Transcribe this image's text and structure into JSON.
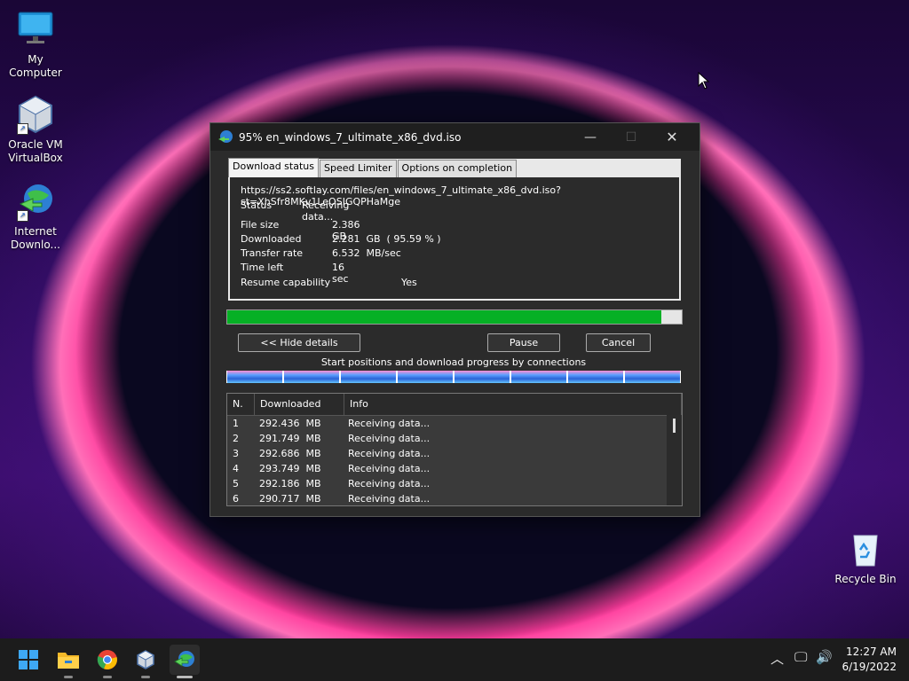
{
  "desktop": {
    "icons": [
      {
        "label": "My Computer"
      },
      {
        "label": "Oracle VM VirtualBox"
      },
      {
        "label": "Internet Downlo..."
      },
      {
        "label": "Recycle Bin"
      }
    ]
  },
  "window": {
    "title": "95% en_windows_7_ultimate_x86_dvd.iso",
    "tabs": [
      "Download status",
      "Speed Limiter",
      "Options on completion"
    ],
    "url": "https://ss2.softlay.com/files/en_windows_7_ultimate_x86_dvd.iso?st=XhSfr8MKv1LeOSIGQPHaMge",
    "status_label": "Status",
    "status_value": "Receiving data...",
    "file_size_label": "File size",
    "file_size_value": "2.386  GB",
    "downloaded_label": "Downloaded",
    "downloaded_value": "2.281  GB  ( 95.59 % )",
    "transfer_rate_label": "Transfer rate",
    "transfer_rate_value": "6.532  MB/sec",
    "time_left_label": "Time left",
    "time_left_value": "16 sec",
    "resume_label": "Resume capability",
    "resume_value": "Yes",
    "progress_percent": 95.59,
    "hide_details_label": "<< Hide details",
    "pause_label": "Pause",
    "cancel_label": "Cancel",
    "connections_label": "Start positions and download progress by connections",
    "connection_segments": 8,
    "table_headers": [
      "N.",
      "Downloaded",
      "Info"
    ],
    "rows": [
      {
        "n": "1",
        "downloaded": "292.436  MB",
        "info": "Receiving data..."
      },
      {
        "n": "2",
        "downloaded": "291.749  MB",
        "info": "Receiving data..."
      },
      {
        "n": "3",
        "downloaded": "292.686  MB",
        "info": "Receiving data..."
      },
      {
        "n": "4",
        "downloaded": "293.749  MB",
        "info": "Receiving data..."
      },
      {
        "n": "5",
        "downloaded": "292.186  MB",
        "info": "Receiving data..."
      },
      {
        "n": "6",
        "downloaded": "290.717  MB",
        "info": "Receiving data..."
      }
    ]
  },
  "taskbar": {
    "apps": [
      "start-icon",
      "file-explorer-icon",
      "chrome-icon",
      "virtualbox-icon",
      "internet-download-manager-icon"
    ],
    "time": "12:27 AM",
    "date": "6/19/2022"
  }
}
